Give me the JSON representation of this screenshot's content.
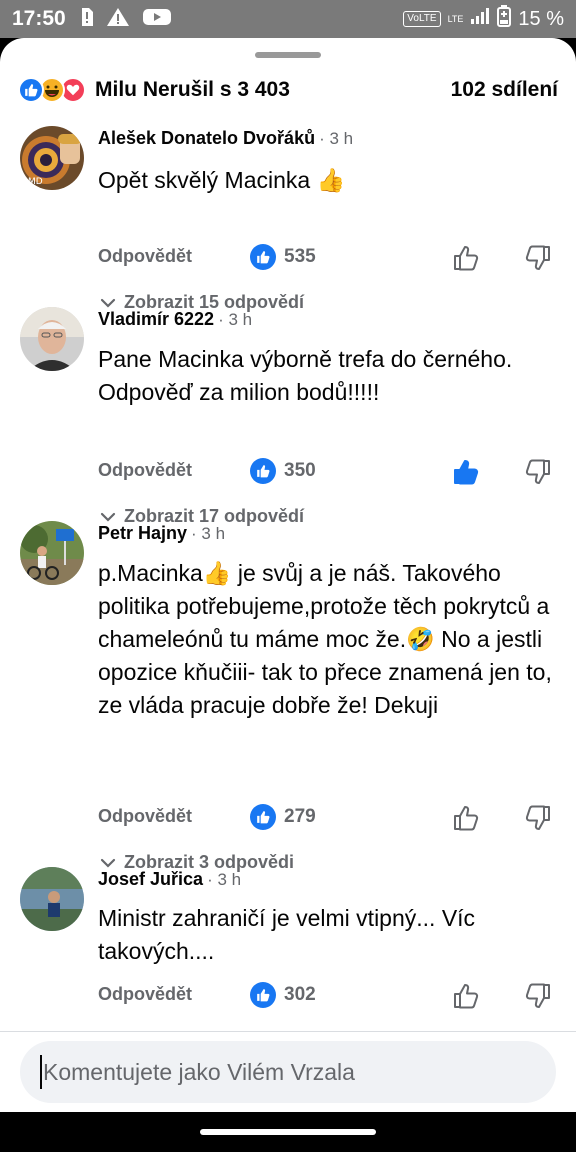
{
  "status_bar": {
    "time": "17:50",
    "network_badge": "VoLTE",
    "network_type": "LTE",
    "battery_percent": "15 %",
    "icons": [
      "sim-alert-icon",
      "warning-icon",
      "youtube-icon",
      "signal-icon",
      "battery-icon"
    ]
  },
  "header": {
    "reaction_icons": [
      "like-icon",
      "haha-icon",
      "love-icon"
    ],
    "reactions_text": "Milu Nerušil s 3 403",
    "shares_text": "102 sdílení"
  },
  "comments": [
    {
      "author": "Alešek Donatelo Dvořáků",
      "time": "· 3 h",
      "text": "Opět skvělý Macinka 👍",
      "reply_label": "Odpovědět",
      "like_count": "535",
      "liked_by_me": false,
      "replies_label": "Zobrazit 15 odpovědí"
    },
    {
      "author": "Vladimír 6222",
      "time": "· 3 h",
      "text": "Pane Macinka výborně trefa do černého. Odpověď za milion bodů!!!!!",
      "reply_label": "Odpovědět",
      "like_count": "350",
      "liked_by_me": true,
      "replies_label": "Zobrazit 17 odpovědí"
    },
    {
      "author": "Petr Hajny",
      "time": "· 3 h",
      "text": "p.Macinka👍 je svůj a je náš. Takového politika potřebujeme,protože těch pokrytců a chameleónů tu máme moc že.🤣 No a jestli opozice kňučiii- tak to přece znamená jen to, ze vláda pracuje dobře že! Dekuji",
      "reply_label": "Odpovědět",
      "like_count": "279",
      "liked_by_me": false,
      "replies_label": "Zobrazit 3 odpovědi"
    },
    {
      "author": "Josef Juřica",
      "time": "· 3 h",
      "text": "Ministr zahraničí je velmi vtipný... Víc takových....",
      "reply_label": "Odpovědět",
      "like_count": "302",
      "liked_by_me": false
    }
  ],
  "composer": {
    "placeholder": "Komentujete jako Vilém Vrzala"
  },
  "colors": {
    "accent": "#1877f2",
    "secondary_text": "#65676b",
    "composer_bg": "#f0f2f5"
  }
}
